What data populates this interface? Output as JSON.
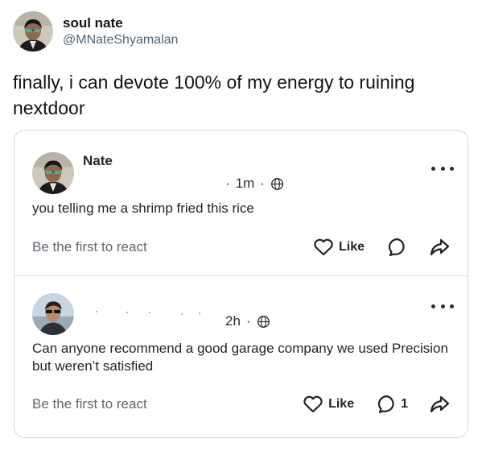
{
  "tweet": {
    "author_name": "soul nate",
    "handle": "@MNateShyamalan",
    "text": "finally, i can devote 100% of my energy to ruining nextdoor"
  },
  "posts": [
    {
      "author": "Nate",
      "time": "1m",
      "separator": "·",
      "lead_dot": "·",
      "body": "you telling me a shrimp fried this rice",
      "react_prompt": "Be the first to react",
      "like_label": "Like",
      "reply_count": ""
    },
    {
      "author": "",
      "time": "2h",
      "separator": "·",
      "body": "Can anyone recommend a good garage company we used Precision but weren’t satisfied",
      "react_prompt": "Be the first to react",
      "like_label": "Like",
      "reply_count": "1"
    }
  ],
  "icons": {
    "more": "more-dots-icon",
    "globe": "globe-icon",
    "like": "heart-icon",
    "reply": "speech-bubble-icon",
    "share": "share-arrow-icon"
  }
}
